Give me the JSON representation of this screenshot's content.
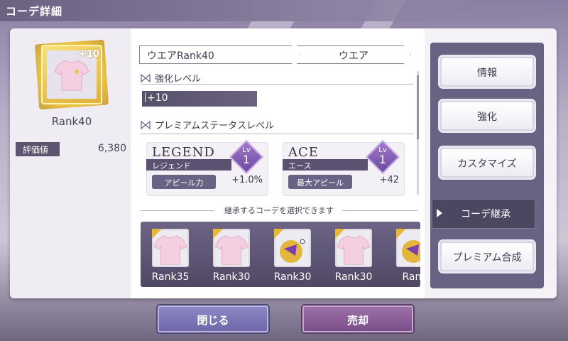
{
  "header": {
    "title": "コーデ詳細"
  },
  "item": {
    "plus": "+10",
    "rank": "Rank40",
    "stat_label": "評価値",
    "stat_value": "6,380"
  },
  "breadcrumb": {
    "name": "ウエアRank40",
    "category": "ウエア"
  },
  "sections": {
    "enhance_level": "強化レベル",
    "enhance_value": "+10",
    "premium_level": "プレミアムステータスレベル"
  },
  "premium_stats": [
    {
      "title": "LEGEND",
      "ruby": "レジェンド",
      "lv_label": "Lv",
      "lv": "1",
      "effect": "アピール力",
      "value": "+1.0%"
    },
    {
      "title": "ACE",
      "ruby": "エース",
      "lv_label": "Lv",
      "lv": "1",
      "effect": "最大アピール",
      "value": "+42"
    }
  ],
  "inherit": {
    "note": "継承するコーデを選択できます",
    "items": [
      {
        "label": "Rank35",
        "icon": "shirt-icon"
      },
      {
        "label": "Rank30",
        "icon": "shirt-icon"
      },
      {
        "label": "Rank30",
        "icon": "potion-icon"
      },
      {
        "label": "Rank30",
        "icon": "shirt-icon"
      },
      {
        "label": "Rank",
        "icon": "potion-icon"
      }
    ]
  },
  "menu": {
    "info": "情報",
    "enhance": "強化",
    "customize": "カスタマイズ",
    "inherit": "コーデ継承",
    "premium": "プレミアム合成"
  },
  "buttons": {
    "close": "閉じる",
    "sell": "売却"
  },
  "colors": {
    "accent": "#6a6283",
    "gold": "#e6b83a",
    "sell": "#7b4f8a"
  }
}
